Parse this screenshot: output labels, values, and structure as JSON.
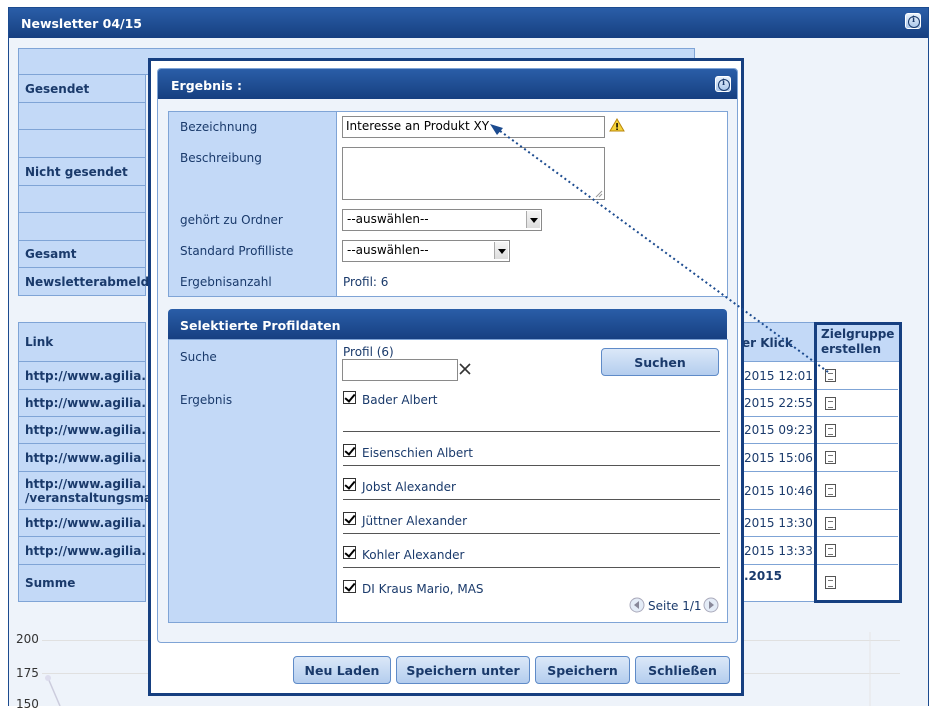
{
  "panel": {
    "title": "Newsletter 04/15"
  },
  "bg_rows": [
    "Gesendet",
    "Nicht gesendet",
    "Gesamt",
    "Newsletterabmeldu"
  ],
  "links_table": {
    "col_link": "Link",
    "col_klick": "er Klick",
    "col_zielgruppe": "Zielgruppe erstellen",
    "rows": [
      {
        "link": "http://www.agilia.",
        "klick": "2015 12:01"
      },
      {
        "link": "http://www.agilia.",
        "klick": "2015 22:55"
      },
      {
        "link": "http://www.agilia.",
        "klick": "2015 09:23"
      },
      {
        "link": "http://www.agilia.",
        "klick": "2015 15:06"
      },
      {
        "link": "http://www.agilia.",
        "link2": "/veranstaltungsma",
        "klick": "2015 10:46"
      },
      {
        "link": "http://www.agilia.",
        "klick": "2015 13:30"
      },
      {
        "link": "http://www.agilia.",
        "klick": "2015 13:33"
      }
    ],
    "summe_label": "Summe",
    "summe_klick": ".2015"
  },
  "chart_axis": [
    "200",
    "175",
    "150"
  ],
  "dialog": {
    "title": "Ergebnis :",
    "bezeichnung_label": "Bezeichnung",
    "bezeichnung_value": "Interesse an Produkt XY",
    "beschreibung_label": "Beschreibung",
    "ordner_label": "gehört zu Ordner",
    "ordner_value": "--auswählen--",
    "profilliste_label": "Standard Profilliste",
    "profilliste_value": "--auswählen--",
    "anzahl_label": "Ergebnisanzahl",
    "anzahl_value": "Profil: 6",
    "section_title": "Selektierte Profildaten",
    "suche_label": "Suche",
    "profil_count": "Profil (6)",
    "suchen_button": "Suchen",
    "ergebnis_label": "Ergebnis",
    "results": [
      "Bader Albert",
      "Eisenschien Albert",
      "Jobst Alexander",
      "Jüttner Alexander",
      "Kohler Alexander",
      "DI Kraus Mario, MAS"
    ],
    "pager": "Seite 1/1",
    "buttons": {
      "neu_laden": "Neu Laden",
      "speichern_unter": "Speichern unter",
      "speichern": "Speichern",
      "schliessen": "Schließen"
    }
  },
  "colors": {
    "header_blue": "#163f80",
    "label_bg": "#c3d9f7",
    "highlight_border": "#163f80"
  }
}
